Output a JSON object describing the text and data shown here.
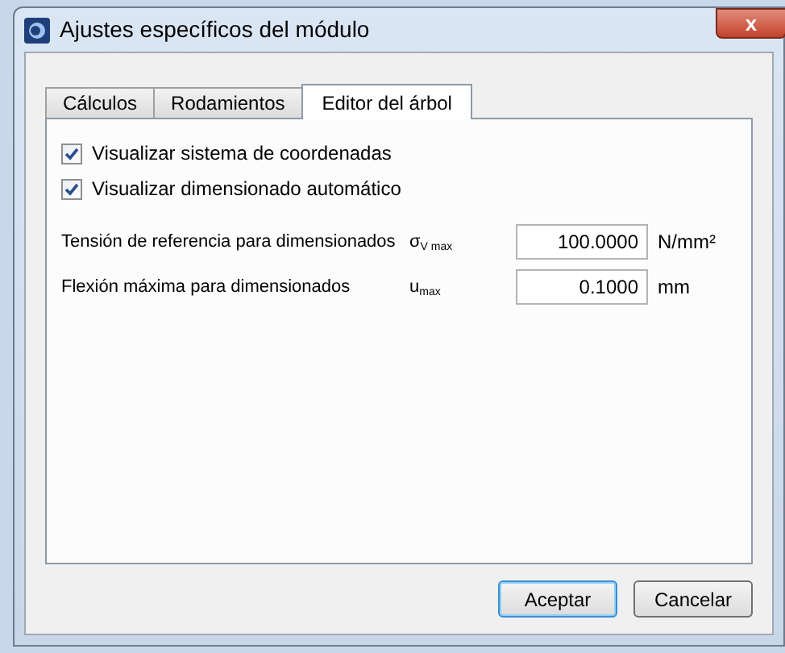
{
  "window": {
    "title": "Ajustes específicos del módulo",
    "close": "x"
  },
  "tabs": [
    {
      "label": "Cálculos",
      "selected": false
    },
    {
      "label": "Rodamientos",
      "selected": false
    },
    {
      "label": "Editor del árbol",
      "selected": true
    }
  ],
  "checkboxes": [
    {
      "label": "Visualizar sistema de coordenadas",
      "checked": true
    },
    {
      "label": "Visualizar dimensionado automático",
      "checked": true
    }
  ],
  "fields": [
    {
      "label": "Tensión de referencia para dimensionados",
      "symbol": "σ$_{V max}$",
      "value": "100.0000",
      "unit": "N/mm²"
    },
    {
      "label": "Flexión máxima para dimensionados",
      "symbol": "u$_{max}$",
      "value": "0.1000",
      "unit": "mm"
    }
  ],
  "buttons": [
    {
      "label": "Aceptar",
      "default": true
    },
    {
      "label": "Cancelar",
      "default": false
    }
  ]
}
